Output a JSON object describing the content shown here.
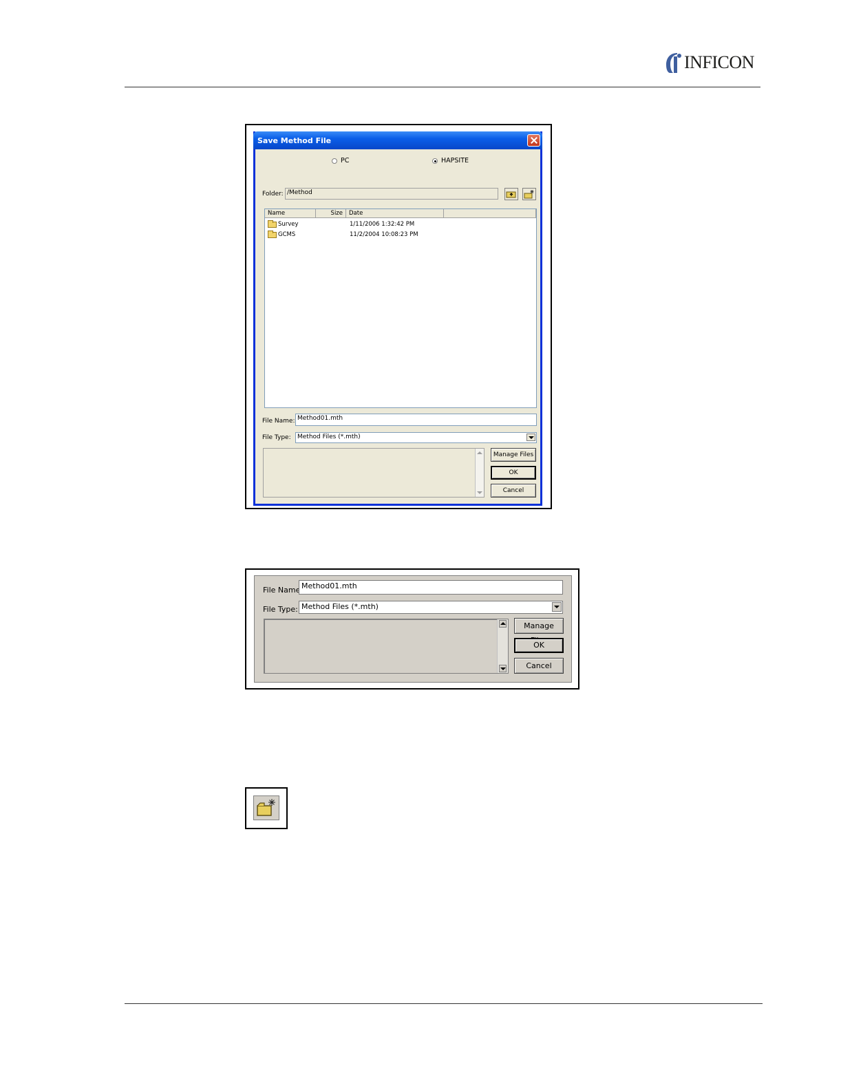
{
  "header": {
    "brand": "INFICON"
  },
  "dialog": {
    "title": "Save Method File",
    "location_options": [
      {
        "label": "PC",
        "selected": false
      },
      {
        "label": "HAPSITE",
        "selected": true
      }
    ],
    "folder_label": "Folder:",
    "folder_value": "/Method",
    "columns": [
      "Name",
      "Size",
      "Date"
    ],
    "files": [
      {
        "name": "Survey",
        "size": "",
        "date": "1/11/2006 1:32:42 PM"
      },
      {
        "name": "GCMS",
        "size": "",
        "date": "11/2/2004 10:08:23 PM"
      }
    ],
    "file_name_label": "File Name:",
    "file_name_value": "Method01.mth",
    "file_type_label": "File Type:",
    "file_type_value": "Method Files (*.mth)",
    "manage_files_label": "Manage Files",
    "ok_label": "OK",
    "cancel_label": "Cancel"
  },
  "zoom_panel": {
    "file_name_label": "File Name:",
    "file_name_value": "Method01.mth",
    "file_type_label": "File Type:",
    "file_type_value": "Method Files (*.mth)",
    "manage_files_label": "Manage Files",
    "ok_label": "OK",
    "cancel_label": "Cancel"
  },
  "icons": [
    "inficon-logo-icon",
    "close-icon",
    "folder-up-icon",
    "new-folder-icon",
    "folder-icon",
    "chevron-down-icon",
    "scroll-up-icon",
    "scroll-down-icon"
  ]
}
